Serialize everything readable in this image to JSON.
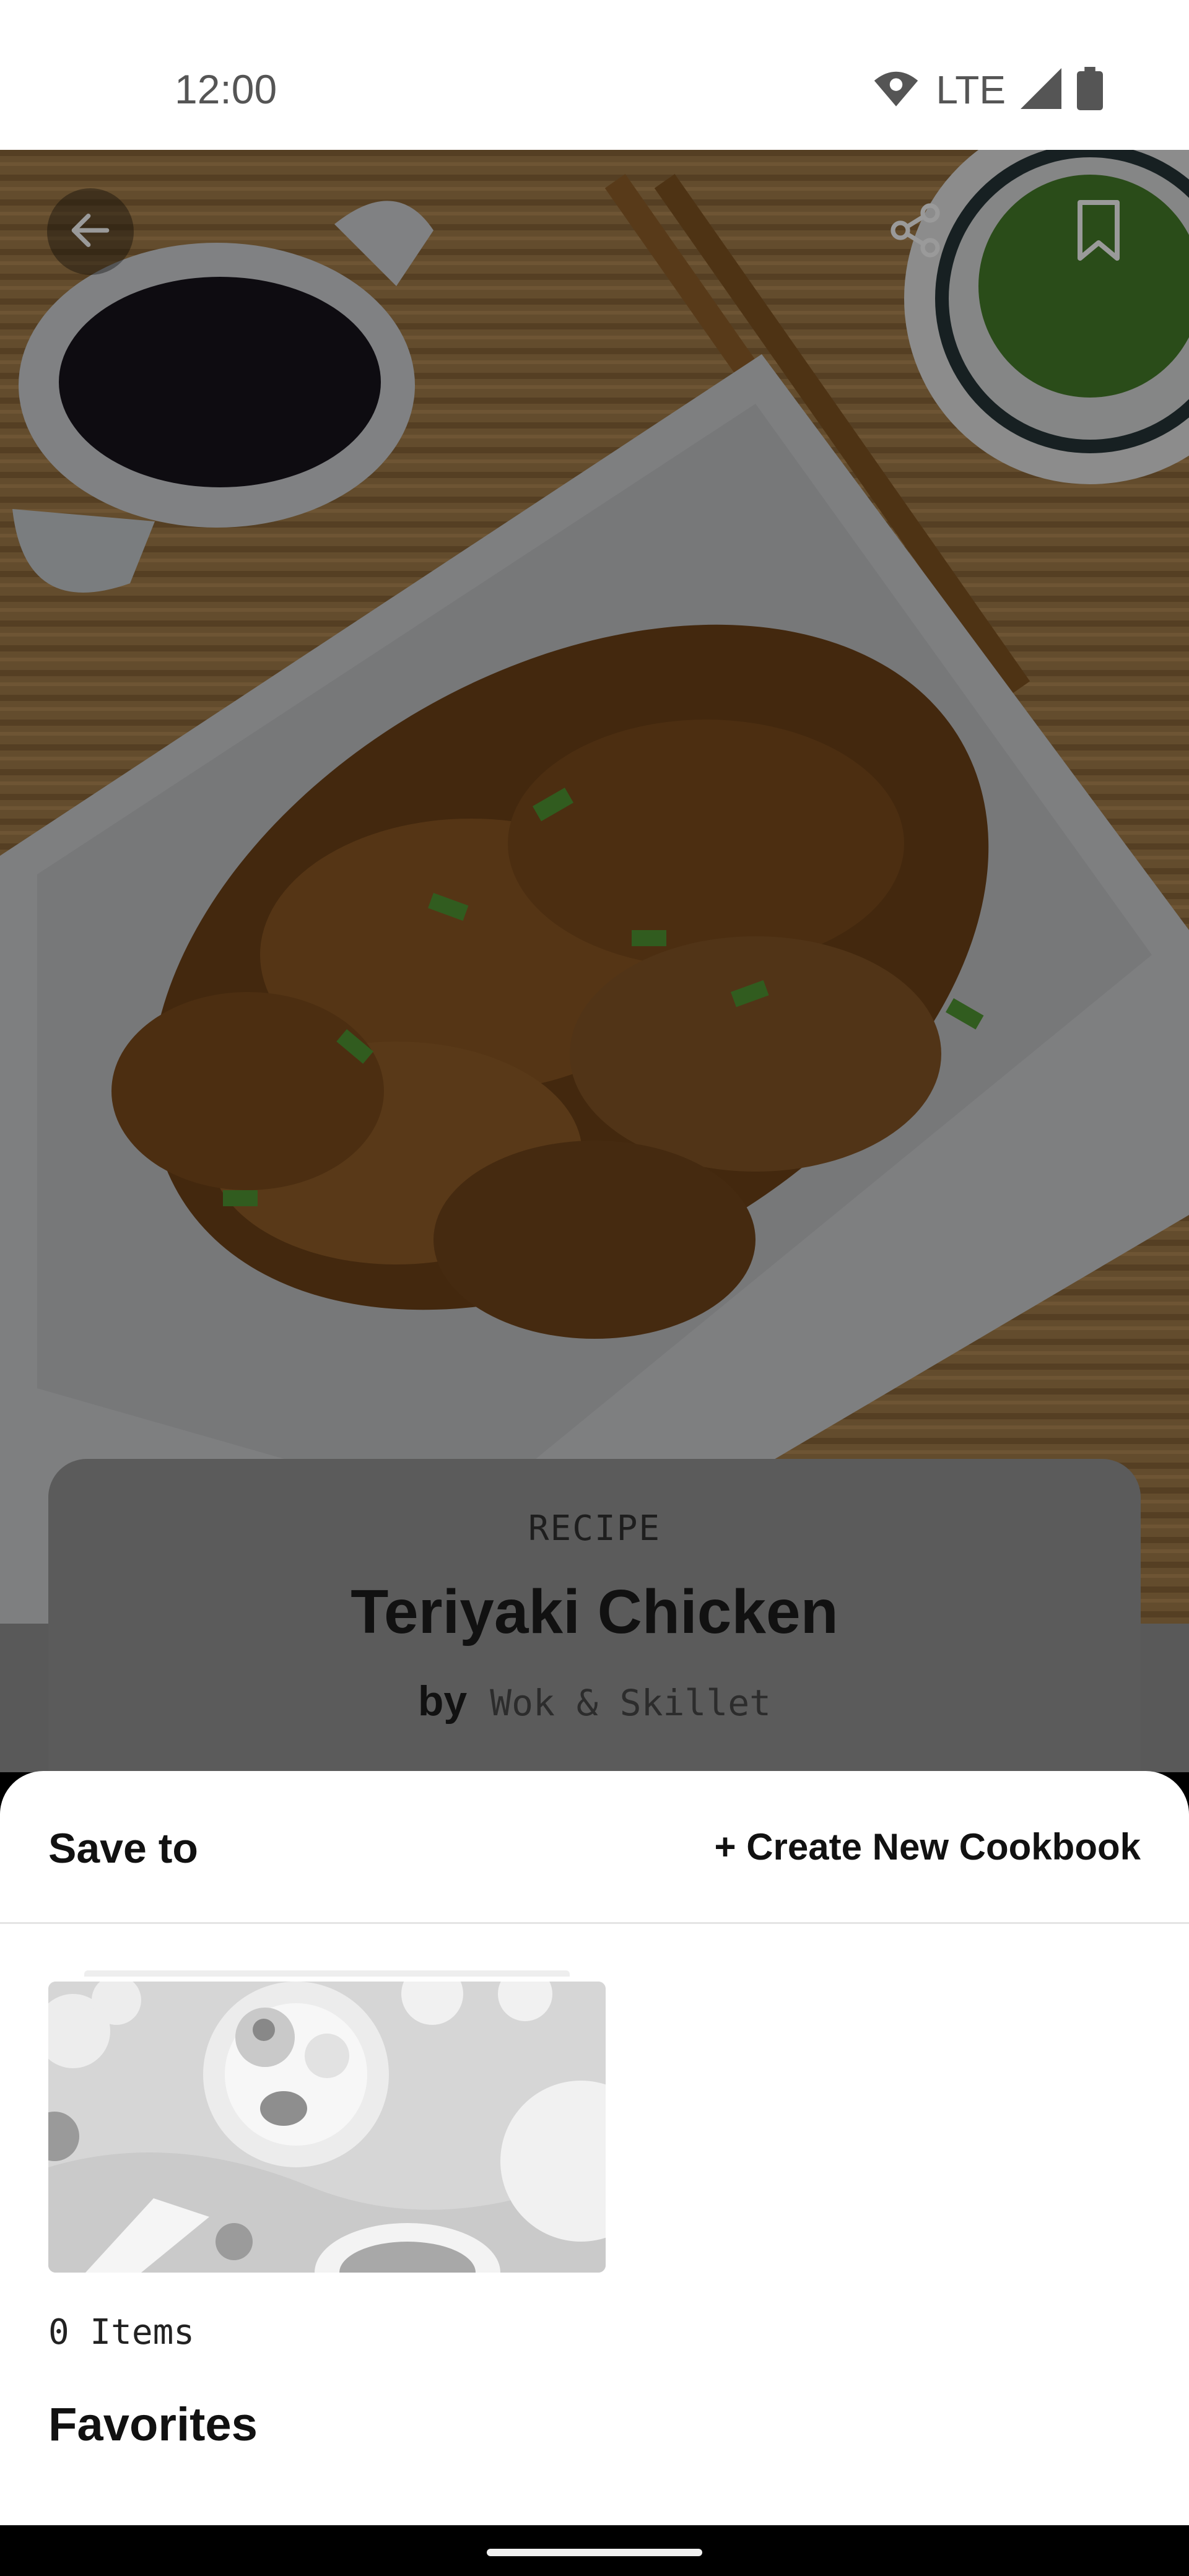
{
  "status_bar": {
    "time": "12:00",
    "network": "LTE",
    "icons": [
      "wifi-icon",
      "signal-icon",
      "battery-icon"
    ]
  },
  "hero": {
    "image": "teriyaki-chicken-photo",
    "buttons": [
      "back-arrow-icon",
      "share-icon",
      "bookmark-icon"
    ]
  },
  "recipe": {
    "kicker": "RECIPE",
    "title": "Teriyaki Chicken",
    "by_label": "by",
    "author": "Wok & Skillet"
  },
  "sheet": {
    "title": "Save to",
    "create_label": "+ Create New Cookbook",
    "cookbooks": [
      {
        "count_label": "0 Items",
        "name": "Favorites"
      }
    ]
  },
  "colors": {
    "overlay": "#000000",
    "sheet_background": "#ffffff",
    "text_primary": "#111111"
  }
}
